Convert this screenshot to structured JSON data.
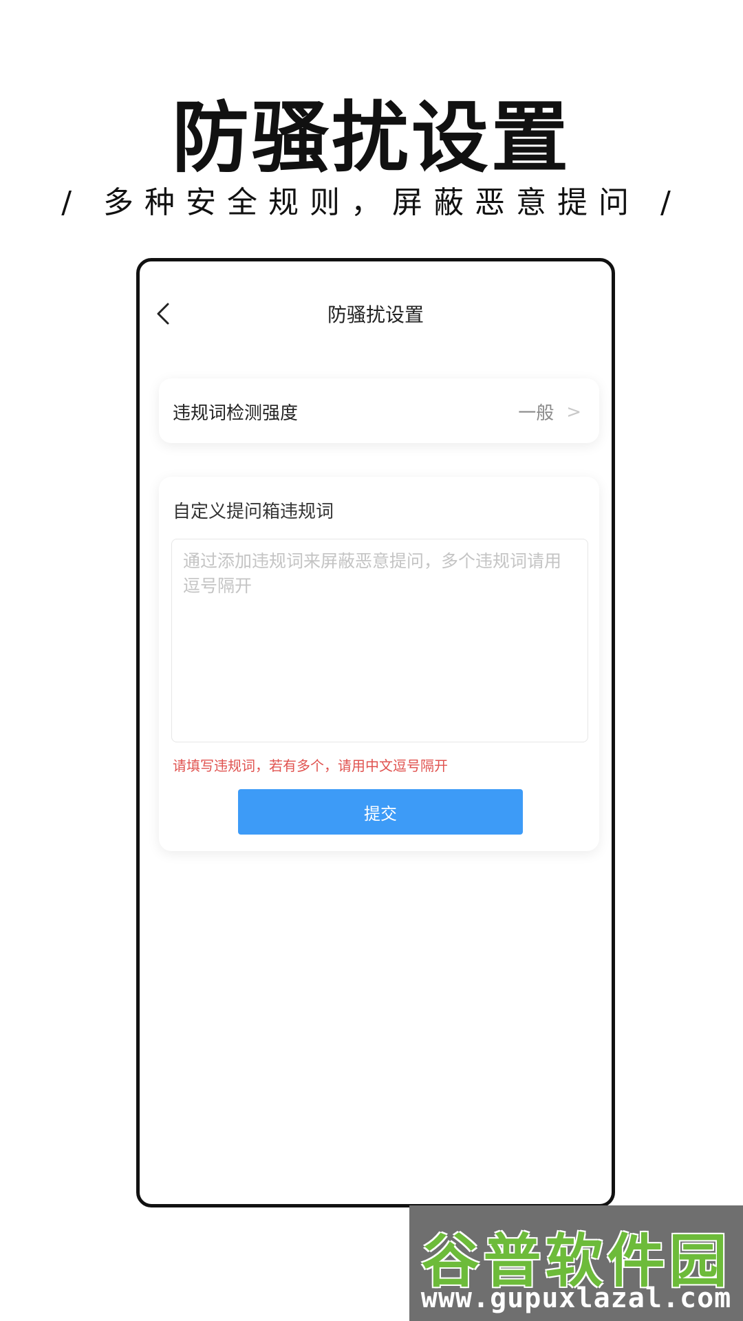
{
  "promo": {
    "title": "防骚扰设置",
    "subtitle": "/ 多种安全规则，屏蔽恶意提问 /"
  },
  "screen": {
    "nav": {
      "back_icon": "chevron-left-icon",
      "title": "防骚扰设置"
    },
    "strength": {
      "label": "违规词检测强度",
      "value": "一般",
      "chevron": ">"
    },
    "custom": {
      "title": "自定义提问箱违规词",
      "input_value": "",
      "input_placeholder": "通过添加违规词来屏蔽恶意提问，多个违规词请用逗号隔开",
      "hint": "请填写违规词，若有多个，请用中文逗号隔开",
      "submit_label": "提交"
    }
  },
  "watermark": {
    "logo_text": "谷普软件园",
    "url": "www.gupuxlazal.com"
  },
  "colors": {
    "accent": "#3d9bf7",
    "hint": "#e0524f",
    "watermark_green": "#6dbb3a"
  }
}
